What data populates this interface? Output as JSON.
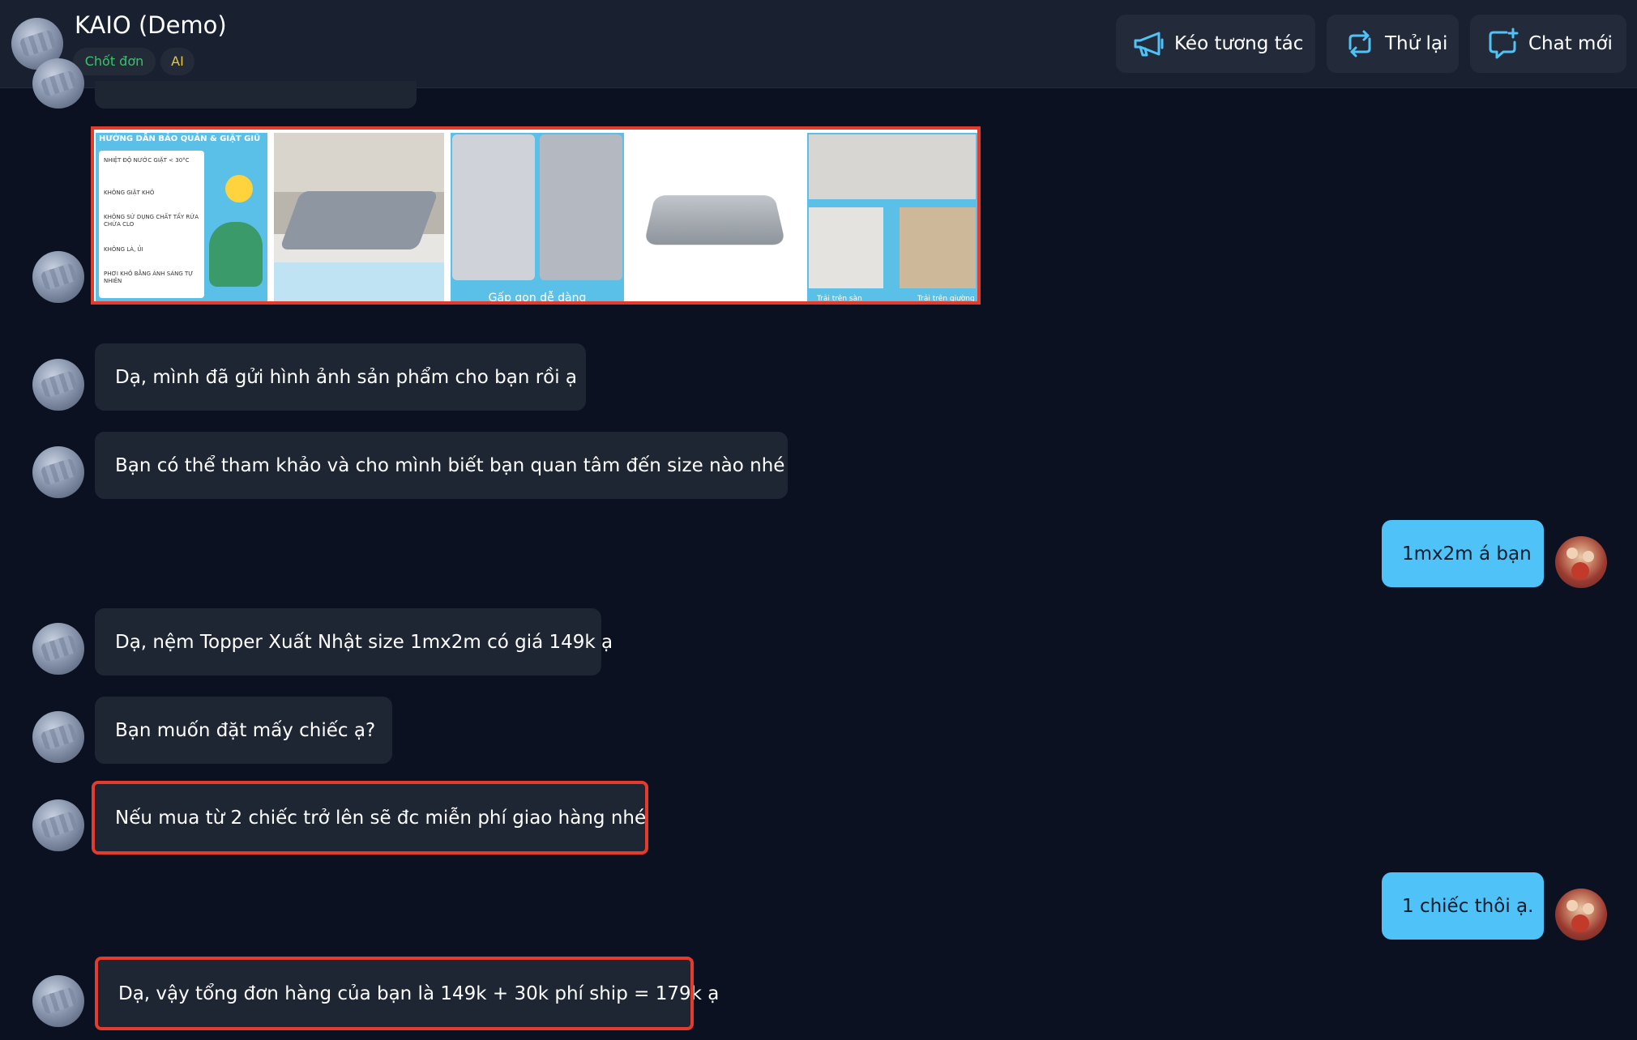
{
  "header": {
    "title": "KAIO (Demo)",
    "tags": [
      "Chốt đơn",
      "AI"
    ],
    "buttons": {
      "pull": "Kéo tương tác",
      "retry": "Thử lại",
      "new_chat": "Chat mới"
    }
  },
  "image_gallery": {
    "care_title": "HƯỚNG DẪN BẢO QUẢN & GIẶT GIŨ",
    "care_items": [
      "NHIỆT ĐỘ NƯỚC GIẶT < 30°C",
      "KHÔNG GIẶT KHÔ",
      "KHÔNG SỬ DỤNG CHẤT TẨY RỬA CHỨA CLO",
      "KHÔNG LÀ, ỦI",
      "PHƠI KHÔ BẰNG ÁNH SÁNG TỰ NHIÊN"
    ],
    "fold_caption": "Gấp gọn dễ dàng",
    "floor_caption": "Trải trên sàn",
    "bed_caption": "Trải trên giường"
  },
  "messages": [
    {
      "from": "bot",
      "text": "Dạ, mình đã gửi hình ảnh sản phẩm cho bạn rồi ạ"
    },
    {
      "from": "bot",
      "text": "Bạn có thể tham khảo và cho mình biết bạn quan tâm đến size nào nhé"
    },
    {
      "from": "user",
      "text": "1mx2m á bạn"
    },
    {
      "from": "bot",
      "text": "Dạ, nệm Topper Xuất Nhật size 1mx2m có giá 149k ạ"
    },
    {
      "from": "bot",
      "text": "Bạn muốn đặt mấy chiếc ạ?"
    },
    {
      "from": "bot",
      "text": "Nếu mua từ 2 chiếc trở lên sẽ đc miễn phí giao hàng nhé"
    },
    {
      "from": "user",
      "text": "1 chiếc thôi ạ."
    },
    {
      "from": "bot",
      "text": "Dạ, vậy tổng đơn hàng của bạn là 149k + 30k phí ship = 179k ạ"
    }
  ],
  "colors": {
    "background": "#0b1120",
    "header": "#19202f",
    "bot_bubble": "#1e2533",
    "user_bubble": "#4fc3f7",
    "highlight": "#e53b2c",
    "accent_icon": "#4fc3f7"
  },
  "icons": [
    "megaphone-icon",
    "retry-icon",
    "chat-plus-icon"
  ]
}
